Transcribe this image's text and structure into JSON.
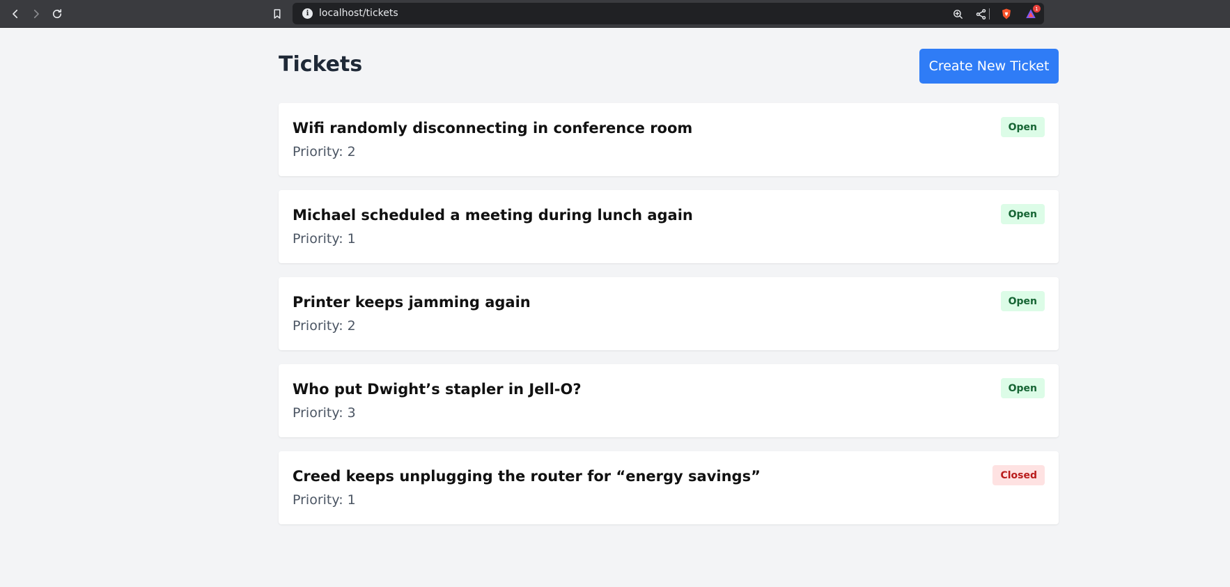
{
  "browser": {
    "url": "localhost/tickets",
    "icons": [
      "back-icon",
      "forward-icon",
      "reload-icon",
      "bookmark-icon",
      "info-icon",
      "zoom-icon",
      "share-icon",
      "brave-shield-icon",
      "brave-rewards-icon"
    ],
    "rewards_badge": "1"
  },
  "page": {
    "title": "Tickets",
    "create_button_label": "Create New Ticket"
  },
  "tickets": [
    {
      "title": "Wifi randomly disconnecting in conference room",
      "priority": "Priority: 2",
      "status": "Open"
    },
    {
      "title": "Michael scheduled a meeting during lunch again",
      "priority": "Priority: 1",
      "status": "Open"
    },
    {
      "title": "Printer keeps jamming again",
      "priority": "Priority: 2",
      "status": "Open"
    },
    {
      "title": "Who put Dwight’s stapler in Jell-O?",
      "priority": "Priority: 3",
      "status": "Open"
    },
    {
      "title": "Creed keeps unplugging the router for “energy savings”",
      "priority": "Priority: 1",
      "status": "Closed"
    }
  ],
  "colors": {
    "accent": "#2f7cf6",
    "open_bg": "#dcfce7",
    "open_text": "#166534",
    "closed_bg": "#fee2e2",
    "closed_text": "#b91c1c"
  }
}
